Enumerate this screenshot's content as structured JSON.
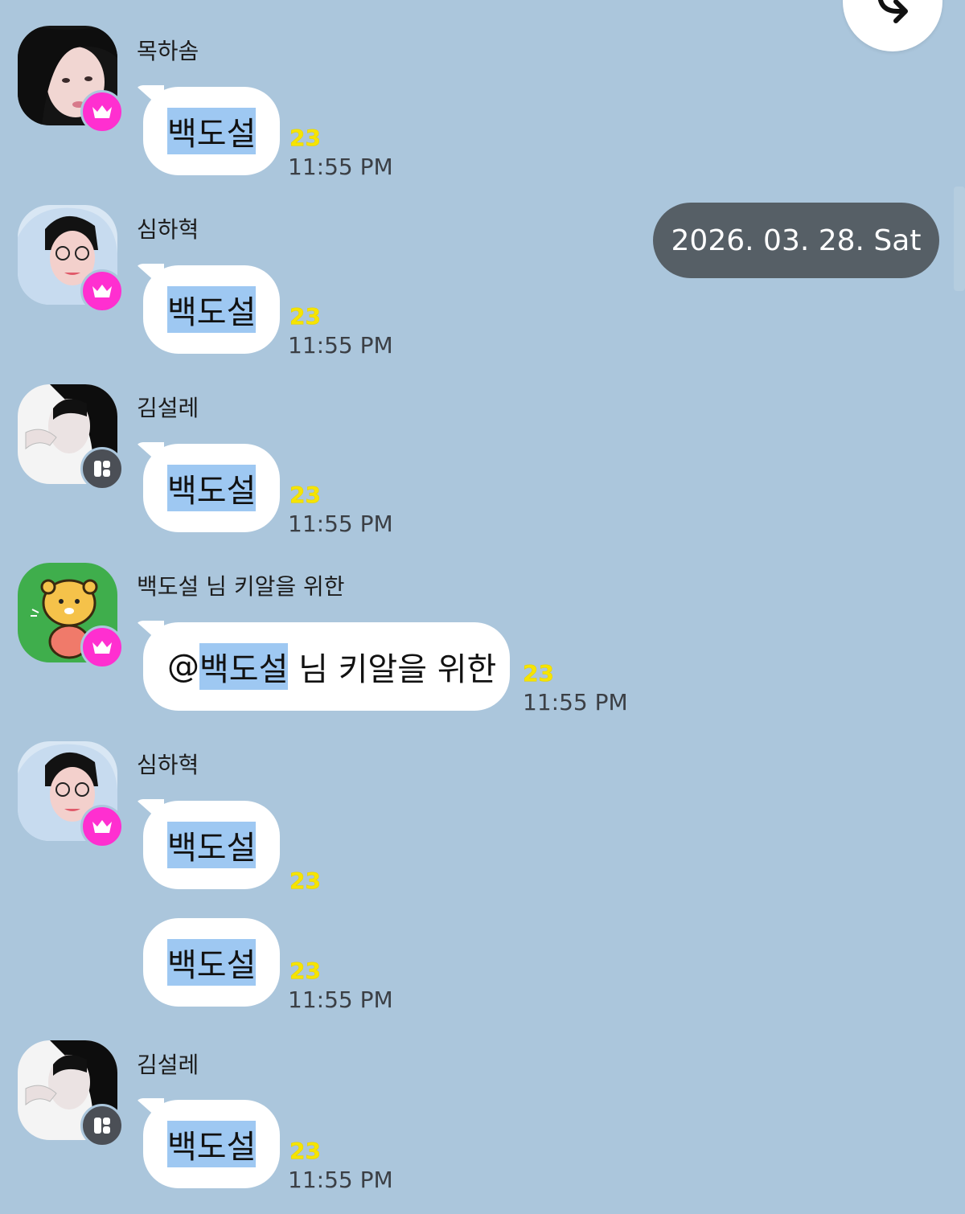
{
  "date_separator": "2026. 03. 28. Sat",
  "messages": [
    {
      "sender": "목하솜",
      "avatar": "photo-girl",
      "badge": "crown-icon",
      "text": "백도설",
      "unread": "23",
      "time": "11:55 PM"
    },
    {
      "sender": "심하혁",
      "avatar": "photo-boy",
      "badge": "crown-icon",
      "text": "백도설",
      "unread": "23",
      "time": "11:55 PM"
    },
    {
      "sender": "김설레",
      "avatar": "photo-girl-2",
      "badge": "manager-icon",
      "text": "백도설",
      "unread": "23",
      "time": "11:55 PM"
    },
    {
      "sender": "백도설 님 키알을 위한",
      "avatar": "ryan-character",
      "badge": "crown-icon",
      "mention_prefix": "@",
      "mention": "백도설",
      "text_suffix": " 님 키알을 위한",
      "unread": "23",
      "time": "11:55 PM"
    },
    {
      "sender": "심하혁",
      "avatar": "photo-boy",
      "badge": "crown-icon",
      "text": "백도설",
      "unread": "23",
      "time": ""
    },
    {
      "sender": "",
      "text": "백도설",
      "unread": "23",
      "time": "11:55 PM"
    },
    {
      "sender": "김설레",
      "avatar": "photo-girl-2",
      "badge": "manager-icon",
      "text": "백도설",
      "unread": "23",
      "time": "11:55 PM"
    }
  ],
  "colors": {
    "background": "#abc6dc",
    "bubble": "#ffffff",
    "highlight": "#9ec8f2",
    "unread": "#f6e400",
    "crown_badge": "#ff2fd0",
    "manager_badge": "#4b4f56",
    "date_pill": "#565f66"
  },
  "icons": {
    "share": "share-arrow-icon"
  }
}
